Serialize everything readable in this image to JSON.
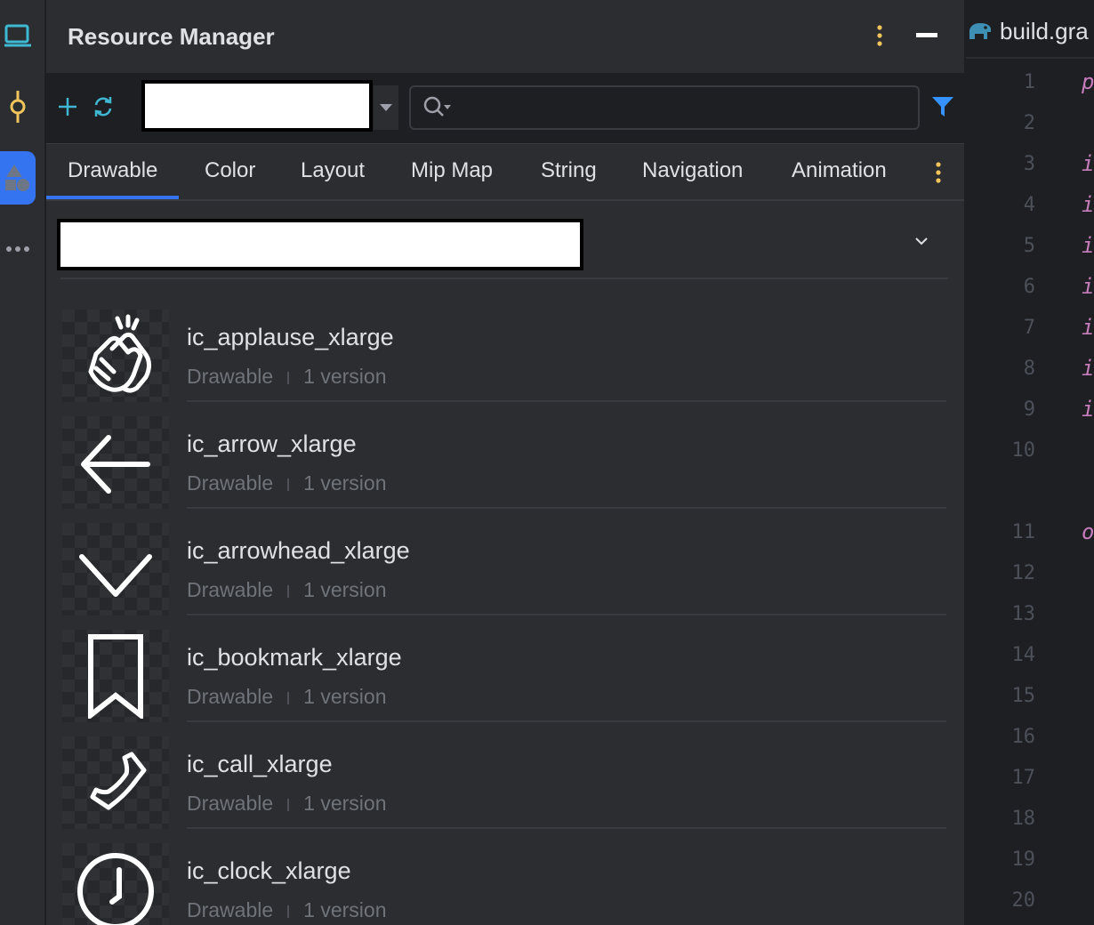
{
  "colors": {
    "accent": "#3574f0",
    "panel": "#2b2d30",
    "background": "#1e1f22",
    "warning_dots": "#f2c55c",
    "filter": "#3592ff"
  },
  "strip": {
    "icons": [
      "monitor-icon",
      "commit-icon",
      "resource-manager-icon",
      "more-icon"
    ]
  },
  "panel": {
    "title": "Resource Manager",
    "module_select": "",
    "search": {
      "value": "",
      "placeholder": ""
    }
  },
  "tabs": [
    {
      "label": "Drawable",
      "active": true
    },
    {
      "label": "Color"
    },
    {
      "label": "Layout"
    },
    {
      "label": "Mip Map"
    },
    {
      "label": "String"
    },
    {
      "label": "Navigation"
    },
    {
      "label": "Animation"
    }
  ],
  "sort_select": "",
  "resources": [
    {
      "name": "ic_applause_xlarge",
      "type": "Drawable",
      "versions": "1 version",
      "icon": "applause-icon"
    },
    {
      "name": "ic_arrow_xlarge",
      "type": "Drawable",
      "versions": "1 version",
      "icon": "arrow-left-icon"
    },
    {
      "name": "ic_arrowhead_xlarge",
      "type": "Drawable",
      "versions": "1 version",
      "icon": "chevron-down-icon"
    },
    {
      "name": "ic_bookmark_xlarge",
      "type": "Drawable",
      "versions": "1 version",
      "icon": "bookmark-icon"
    },
    {
      "name": "ic_call_xlarge",
      "type": "Drawable",
      "versions": "1 version",
      "icon": "phone-icon"
    },
    {
      "name": "ic_clock_xlarge",
      "type": "Drawable",
      "versions": "1 version",
      "icon": "clock-icon"
    }
  ],
  "editor": {
    "tab_label": "build.gra",
    "line_numbers": [
      "1",
      "2",
      "3",
      "4",
      "5",
      "6",
      "7",
      "8",
      "9",
      "10",
      "11",
      "12",
      "13",
      "14",
      "15",
      "16",
      "17",
      "18",
      "19",
      "20"
    ],
    "code_glyphs": [
      "p",
      "i",
      "i",
      "i",
      "i",
      "i",
      "i",
      "i",
      "o"
    ]
  }
}
